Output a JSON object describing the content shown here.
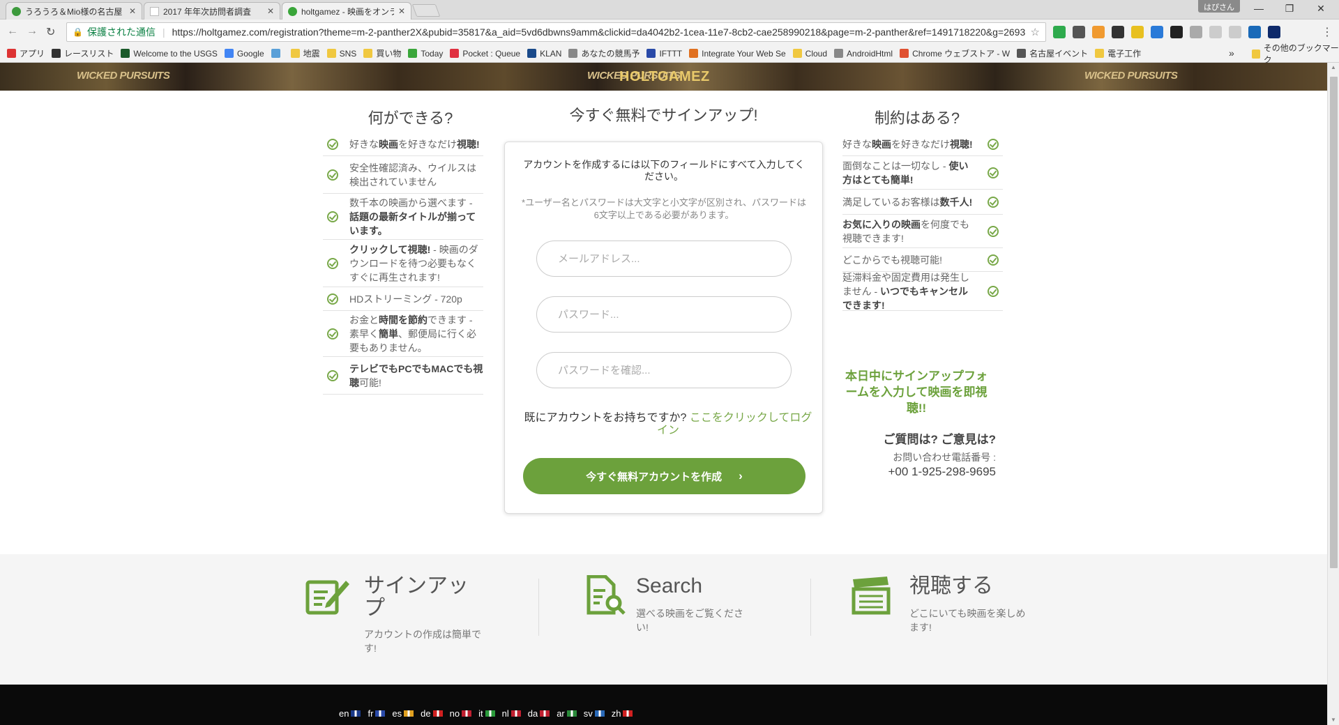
{
  "browser": {
    "tabs": [
      {
        "label": "うろうろ＆Mio様の名古屋ドキ",
        "favicon_color": "#3c9a3c"
      },
      {
        "label": "2017 年年次訪問者調査",
        "favicon_color": "#ffffff"
      },
      {
        "label": "holtgamez - 映画をオンライン",
        "favicon_color": "#3aa63a"
      }
    ],
    "user_badge": "はぴさん",
    "secure_label": "保護された通信",
    "url": "https://holtgamez.com/registration?theme=m-2-panther2X&pubid=35817&a_aid=5vd6dbwns9amm&clickid=da4042b2-1cea-11e7-8cb2-cae258990218&page=m-2-panther&ref=1491718220&g=2693",
    "extensions": [
      "#2eaa4d",
      "#555555",
      "#f09a30",
      "#333333",
      "#e8c020",
      "#2a7ad8",
      "#222222",
      "#aaaaaa",
      "#cccccc",
      "#cccccc",
      "#1a6ab8",
      "#0e2a6a"
    ],
    "bookmarks": [
      {
        "label": "アプリ",
        "color": "#d33"
      },
      {
        "label": "レースリスト",
        "color": "#333"
      },
      {
        "label": "Welcome to the USGS",
        "color": "#1a5a2a"
      },
      {
        "label": "Google",
        "color": "#4285f4"
      },
      {
        "label": "",
        "color": "#5aa0d8"
      },
      {
        "label": "地震",
        "color": "#f0c840"
      },
      {
        "label": "SNS",
        "color": "#f0c840"
      },
      {
        "label": "買い物",
        "color": "#f0c840"
      },
      {
        "label": "Today",
        "color": "#3aa63a"
      },
      {
        "label": "Pocket : Queue",
        "color": "#e03040"
      },
      {
        "label": "KLAN",
        "color": "#1a4a8a"
      },
      {
        "label": "あなたの競馬予",
        "color": "#888"
      },
      {
        "label": "IFTTT",
        "color": "#2a4aa8"
      },
      {
        "label": "Integrate Your Web Se",
        "color": "#e07020"
      },
      {
        "label": "Cloud",
        "color": "#f0c840"
      },
      {
        "label": "AndroidHtml",
        "color": "#888"
      },
      {
        "label": "Chrome ウェブストア - W",
        "color": "#e05030"
      },
      {
        "label": "名古屋イベント",
        "color": "#555"
      },
      {
        "label": "電子工作",
        "color": "#f0c840"
      }
    ],
    "bookmarks_more": "»",
    "other_bookmarks": "その他のブックマーク"
  },
  "banner": {
    "logo": "HOLTGAMEZ",
    "tile_text": "WICKED PURSUITS"
  },
  "left_column": {
    "heading": "何ができる?",
    "items": [
      {
        "pre": "好きな",
        "b1": "映画",
        "mid": "を好きなだけ",
        "b2": "視聴!",
        "post": ""
      },
      {
        "pre": "安全性確認済み、ウイルスは検出されていません",
        "b1": "",
        "mid": "",
        "b2": "",
        "post": ""
      },
      {
        "pre": "数千本の映画から選べます - ",
        "b1": "話題の最新タイトルが揃っています。",
        "mid": "",
        "b2": "",
        "post": ""
      },
      {
        "pre": "",
        "b1": "クリックして視聴!",
        "mid": " - 映画のダウンロードを待つ必要もなくすぐに再生されます!",
        "b2": "",
        "post": ""
      },
      {
        "pre": "HDストリーミング - 720p",
        "b1": "",
        "mid": "",
        "b2": "",
        "post": ""
      },
      {
        "pre": "お金と",
        "b1": "時間を節約",
        "mid": "できます - 素早く",
        "b2": "簡単",
        "post": "、郵便局に行く必要もありません。"
      },
      {
        "pre": "",
        "b1": "テレビでもPCでもMACでも視聴",
        "mid": "可能!",
        "b2": "",
        "post": ""
      }
    ]
  },
  "signup": {
    "heading": "今すぐ無料でサインアップ!",
    "instruction": "アカウントを作成するには以下のフィールドにすべて入力してください。",
    "note": "*ユーザー名とパスワードは大文字と小文字が区別され、パスワードは6文字以上である必要があります。",
    "email_placeholder": "メールアドレス...",
    "password_placeholder": "パスワード...",
    "confirm_placeholder": "パスワードを確認...",
    "have_account": "既にアカウントをお持ちですか? ",
    "login_link": "ここをクリックしてログイン",
    "cta_label": "今すぐ無料アカウントを作成",
    "accent_color": "#6ca13c"
  },
  "right_column": {
    "heading": "制約はある?",
    "items": [
      {
        "pre": "好きな",
        "b1": "映画",
        "mid": "を好きなだけ",
        "b2": "視聴!",
        "post": ""
      },
      {
        "pre": "面倒なことは一切なし - ",
        "b1": "使い方はとても簡単!",
        "mid": "",
        "b2": "",
        "post": ""
      },
      {
        "pre": "満足しているお客様は",
        "b1": "数千人!",
        "mid": "",
        "b2": "",
        "post": ""
      },
      {
        "pre": "",
        "b1": "お気に入りの映画",
        "mid": "を何度でも視聴できます!",
        "b2": "",
        "post": ""
      },
      {
        "pre": "どこからでも視聴可能!",
        "b1": "",
        "mid": "",
        "b2": "",
        "post": ""
      },
      {
        "pre": "延滞料金や固定費用は発生しません - ",
        "b1": "いつでもキャンセルできます!",
        "mid": "",
        "b2": "",
        "post": ""
      }
    ],
    "promo": "本日中にサインアップフォームを入力して映画を即視聴!!",
    "question_heading": "ご質問は? ご意見は?",
    "phone_label": "お問い合わせ電話番号 :",
    "phone": "+00 1-925-298-9695"
  },
  "steps": [
    {
      "title": "サインアップ",
      "subtitle": "アカウントの作成は簡単です!",
      "icon": "signup-icon"
    },
    {
      "title": "Search",
      "subtitle": "選べる映画をご覧ください!",
      "icon": "search-doc-icon"
    },
    {
      "title": "視聴する",
      "subtitle": "どこにいても映画を楽しめます!",
      "icon": "clapperboard-icon"
    }
  ],
  "languages": [
    {
      "code": "en",
      "flag": "#1a3a8a"
    },
    {
      "code": "fr",
      "flag": "#2a4aa8"
    },
    {
      "code": "es",
      "flag": "#e0a020"
    },
    {
      "code": "de",
      "flag": "#d02020"
    },
    {
      "code": "no",
      "flag": "#c02030"
    },
    {
      "code": "it",
      "flag": "#2a9a3a"
    },
    {
      "code": "nl",
      "flag": "#c02030"
    },
    {
      "code": "da",
      "flag": "#c02030"
    },
    {
      "code": "ar",
      "flag": "#2a8a3a"
    },
    {
      "code": "sv",
      "flag": "#2a6ab8"
    },
    {
      "code": "zh",
      "flag": "#d02020"
    }
  ]
}
